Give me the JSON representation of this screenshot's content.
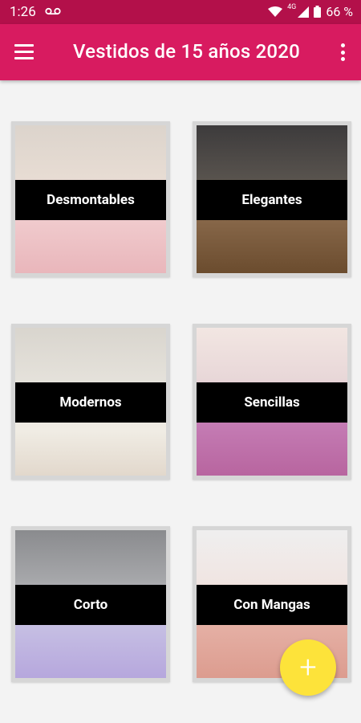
{
  "status_bar": {
    "time": "1:26",
    "network": "4G",
    "battery": "66 %"
  },
  "app_bar": {
    "title": "Vestidos de 15 años 2020",
    "menu_icon": "hamburger-menu-icon",
    "more_icon": "more-vert-icon"
  },
  "categories": [
    {
      "label": "Desmontables"
    },
    {
      "label": "Elegantes"
    },
    {
      "label": "Modernos"
    },
    {
      "label": "Sencillas"
    },
    {
      "label": "Corto"
    },
    {
      "label": "Con Mangas"
    }
  ],
  "fab": {
    "label": "+",
    "icon": "plus-icon"
  },
  "colors": {
    "status_bar": "#b3104a",
    "app_bar": "#d81b60",
    "background": "#f3f3f3",
    "fab": "#fde33a",
    "banner": "#000000"
  }
}
